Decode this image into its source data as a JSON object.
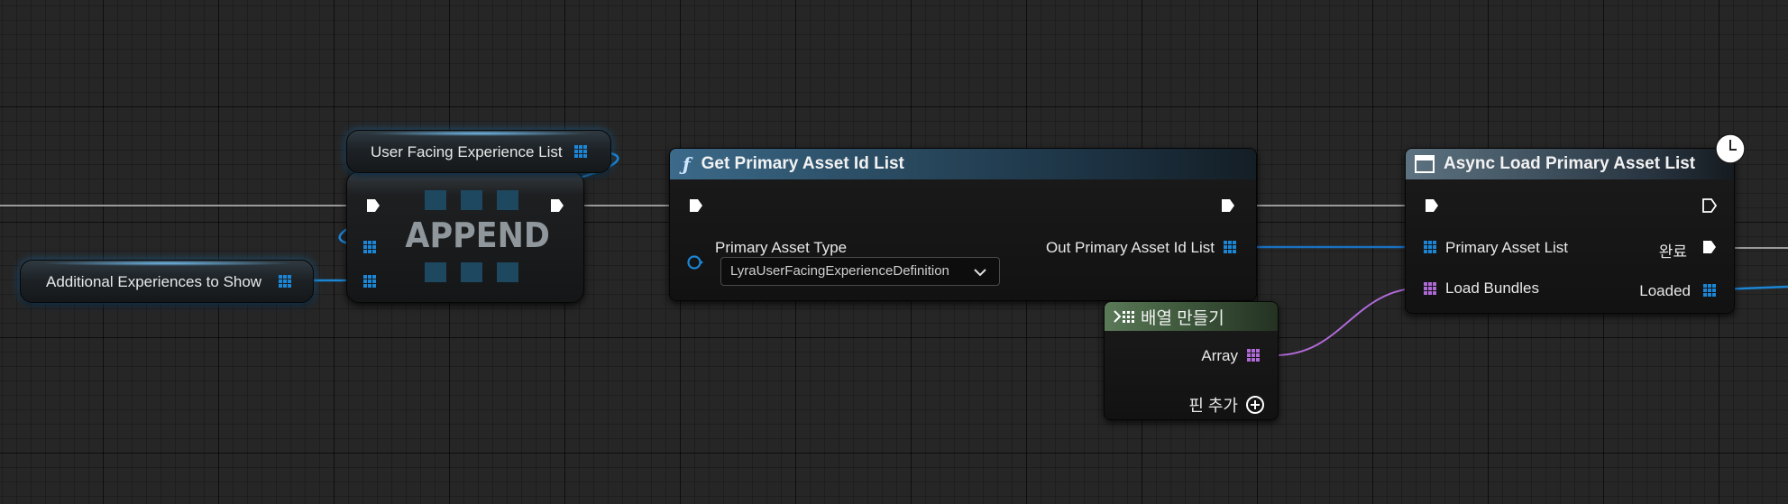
{
  "nodes": {
    "append": {
      "title": "APPEND"
    },
    "user_facing_var": {
      "label": "User Facing Experience List"
    },
    "additional_var": {
      "label": "Additional Experiences to Show"
    },
    "get_primary": {
      "title": "Get Primary Asset Id List",
      "function_symbol": "ƒ",
      "input_label": "Primary Asset Type",
      "dropdown_value": "LyraUserFacingExperienceDefinition",
      "output_label": "Out Primary Asset Id List"
    },
    "async_load": {
      "title": "Async Load Primary Asset List",
      "in_list_label": "Primary Asset List",
      "in_bundles_label": "Load Bundles",
      "completed_label": "완료",
      "loaded_label": "Loaded"
    },
    "make_array": {
      "title": "배열 만들기",
      "array_label": "Array",
      "add_pin_label": "핀 추가"
    }
  },
  "colors": {
    "exec": "#ffffff",
    "array_blue": "#1b86d6",
    "array_purple": "#b06ad8",
    "exec_wire": "#a8a8a8",
    "grid_bg": "#262626"
  },
  "icons": {
    "function": "function-icon",
    "async": "window-icon",
    "clock": "clock-icon",
    "make_array": "make-array-icon",
    "add_pin": "plus-circle-icon"
  }
}
